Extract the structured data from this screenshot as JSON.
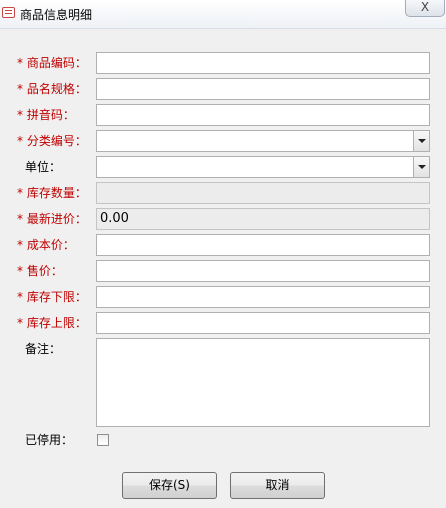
{
  "window": {
    "title": "商品信息明细",
    "close_glyph": "X"
  },
  "form": {
    "code_label": "商品编码：",
    "name_label": "品名规格：",
    "pinyin_label": "拼音码：",
    "category_label": "分类编号：",
    "unit_label": "单位：",
    "stock_qty_label": "库存数量：",
    "latest_price_label": "最新进价：",
    "latest_price_value": "0.00",
    "cost_label": "成本价：",
    "sale_price_label": "售价：",
    "stock_min_label": "库存下限：",
    "stock_max_label": "库存上限：",
    "remark_label": "备注：",
    "disabled_label": "已停用："
  },
  "buttons": {
    "save": "保存(S)",
    "cancel": "取消"
  },
  "colors": {
    "required_label": "#c00000"
  }
}
